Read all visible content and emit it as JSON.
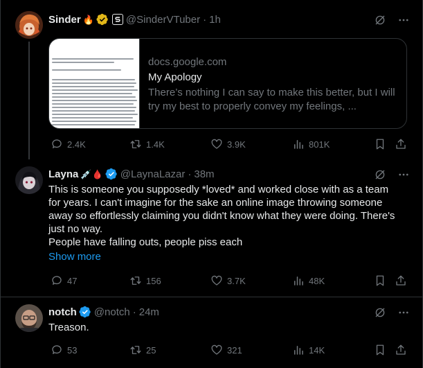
{
  "tweets": [
    {
      "name": "Sinder",
      "name_emoji": "🔥",
      "handle": "@SinderVTuber",
      "time": "1h",
      "card": {
        "domain": "docs.google.com",
        "title": "My Apology",
        "description": "There’s nothing I can say to make this better, but I will try my best to properly convey my feelings, ..."
      },
      "stats": {
        "replies": "2.4K",
        "retweets": "1.4K",
        "likes": "3.9K",
        "views": "801K"
      }
    },
    {
      "name": "Layna",
      "name_emoji": "💉🩸",
      "handle": "@LaynaLazar",
      "time": "38m",
      "text_lines": [
        "This is someone you supposedly *loved* and worked close with as a team",
        "for years. I can't imagine for the sake an online image throwing someone",
        "away so effortlessly claiming you didn't know what they were doing. There's",
        "just no way.",
        "People have falling outs, people piss each"
      ],
      "show_more": "Show more",
      "stats": {
        "replies": "47",
        "retweets": "156",
        "likes": "3.7K",
        "views": "48K"
      }
    },
    {
      "name": "notch",
      "handle": "@notch",
      "time": "24m",
      "text": "Treason.",
      "stats": {
        "replies": "53",
        "retweets": "25",
        "likes": "321",
        "views": "14K"
      }
    }
  ],
  "colors": {
    "background": "#000000",
    "text": "#e7e9ea",
    "muted": "#71767b",
    "accent": "#1d9bf0",
    "verified_gold": "#e2b719",
    "border": "#2f3336"
  }
}
